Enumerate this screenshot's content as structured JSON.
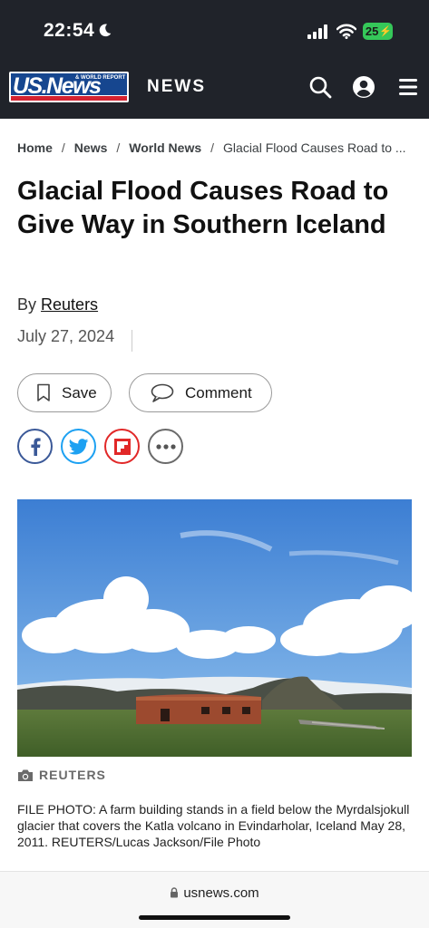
{
  "status_bar": {
    "time": "22:54",
    "battery": "25",
    "icons": [
      "moon-icon",
      "signal-icon",
      "wifi-icon",
      "battery-icon"
    ]
  },
  "header": {
    "logo_main": "US.News",
    "logo_small_1": "& WORLD REPORT",
    "section": "NEWS",
    "icons": [
      "search-icon",
      "account-icon",
      "menu-icon"
    ]
  },
  "breadcrumb": {
    "home": "Home",
    "news": "News",
    "world_news": "World News",
    "current": "Glacial Flood Causes Road to ..."
  },
  "article": {
    "headline": "Glacial Flood Causes Road to Give Way in Southern Iceland",
    "by_prefix": "By",
    "author": "Reuters",
    "date": "July 27, 2024"
  },
  "actions": {
    "save_label": "Save",
    "comment_label": "Comment"
  },
  "share_icons": [
    "facebook-icon",
    "twitter-icon",
    "flipboard-icon",
    "more-icon"
  ],
  "photo": {
    "credit": "REUTERS",
    "caption": "FILE PHOTO: A farm building stands in a field below the Myrdalsjokull glacier that covers the Katla volcano in Evindarholar, Iceland May 28, 2011. REUTERS/Lucas Jackson/File Photo"
  },
  "browser": {
    "url": "usnews.com"
  },
  "colors": {
    "header_bg": "#20232a",
    "logo_blue": "#16468f",
    "logo_red": "#d42230",
    "facebook": "#3b5998",
    "twitter": "#1da1f2",
    "flipboard": "#e12828",
    "battery_green": "#35c759"
  }
}
